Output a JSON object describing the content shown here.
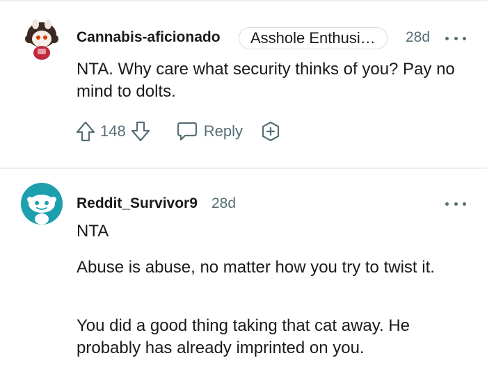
{
  "comments": [
    {
      "username": "Cannabis-aficionado",
      "flair": "Asshole Enthusi…",
      "time": "28d",
      "paragraphs": [
        "NTA. Why care what security thinks of you? Pay no mind to dolts."
      ],
      "votes": "148",
      "reply_label": "Reply"
    },
    {
      "username": "Reddit_Survivor9",
      "time": "28d",
      "paragraphs": [
        "NTA",
        "Abuse is abuse, no matter how you try to twist it.",
        "You did a good thing taking that cat away. He probably has already imprinted on you."
      ]
    }
  ],
  "colors": {
    "text": "#1a1a1b",
    "meta": "#576f76",
    "divider": "#edeff1",
    "avatar_teal": "#1e9fae"
  }
}
